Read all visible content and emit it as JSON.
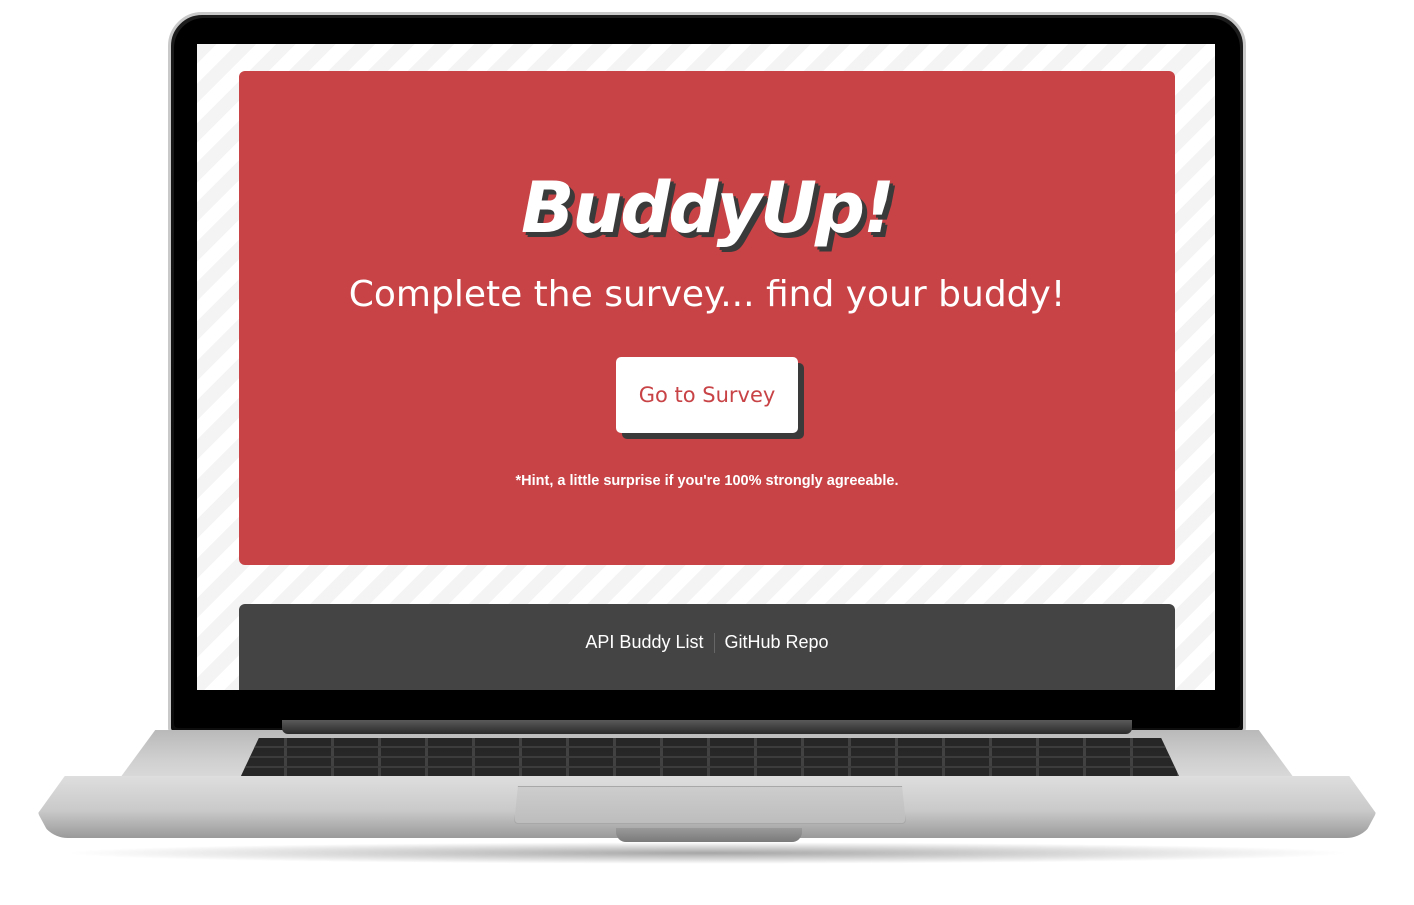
{
  "hero": {
    "logo": "BuddyUp!",
    "tagline": "Complete the survey... find your buddy!",
    "survey_button_label": "Go to Survey",
    "hint": "*Hint, a little surprise if you're 100% strongly agreeable."
  },
  "footer": {
    "links": [
      {
        "label": "API Buddy List"
      },
      {
        "label": "GitHub Repo"
      }
    ]
  },
  "colors": {
    "hero_background": "#c84346",
    "footer_background": "#444444",
    "button_text": "#c84346"
  }
}
